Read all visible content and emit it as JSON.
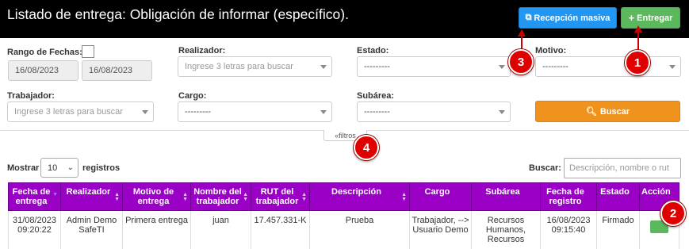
{
  "header": {
    "title": "Listado de entrega: Obligación de informar (específico).",
    "btn_masiva": "Recepción masiva",
    "btn_entregar": "Entregar"
  },
  "filters": {
    "rango_label": "Rango de Fechas:",
    "date_from": "16/08/2023",
    "date_to": "16/08/2023",
    "realizador_label": "Realizador:",
    "realizador_placeholder": "Ingrese 3 letras para buscar",
    "estado_label": "Estado:",
    "estado_value": "---------",
    "motivo_label": "Motivo:",
    "motivo_value": "---------",
    "trabajador_label": "Trabajador:",
    "trabajador_placeholder": "Ingrese 3 letras para buscar",
    "cargo_label": "Cargo:",
    "cargo_value": "---------",
    "subarea_label": "Subárea:",
    "subarea_value": "---------",
    "buscar_btn": "Buscar",
    "filtros_toggle": "filtros"
  },
  "table_controls": {
    "mostrar": "Mostrar",
    "page_length": "10",
    "registros": "registros",
    "buscar_label": "Buscar:",
    "search_placeholder": "Descripción, nombre o rut"
  },
  "table": {
    "headers": [
      "Fecha de entrega",
      "Realizador",
      "Motivo de entrega",
      "Nombre del trabajador",
      "RUT del trabajador",
      "Descripción",
      "Cargo",
      "Subárea",
      "Fecha de registro",
      "Estado",
      "Acción"
    ],
    "rows": [
      {
        "fecha_entrega": "31/08/2023 09:20:22",
        "realizador": "Admin Demo SafeTI",
        "motivo": "Primera entrega",
        "nombre": "juan",
        "rut": "17.457.331-K",
        "descripcion": "Prueba",
        "cargo": "Trabajador, --> Usuario Demo",
        "subarea": "Recursos Humanos, Recursos",
        "fecha_registro": "16/08/2023 09:15:40",
        "estado": "Firmado"
      }
    ]
  },
  "annotations": [
    "1",
    "2",
    "3",
    "4"
  ],
  "colors": {
    "header_bg": "#000000",
    "table_header": "#9b00c7",
    "masiva": "#2196f3",
    "entregar": "#5cb85c",
    "buscar": "#f0921e",
    "annotation": "#e00000"
  },
  "icons": [
    "copy-icon",
    "plus-icon",
    "search-icon",
    "chevron-up-icon",
    "sort-icon"
  ]
}
